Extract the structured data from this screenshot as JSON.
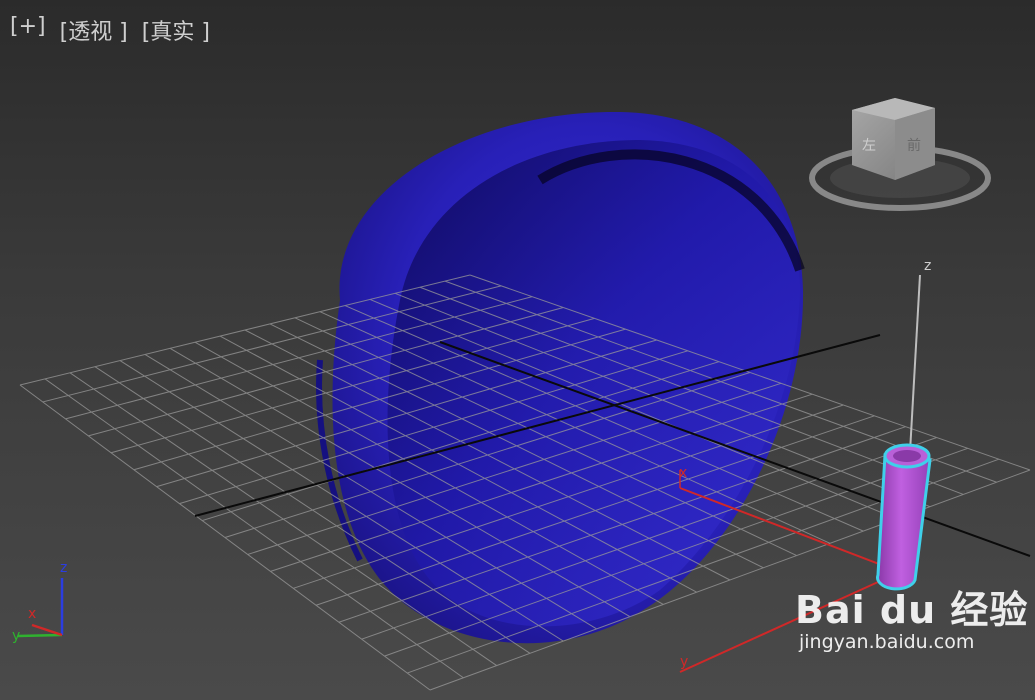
{
  "viewport": {
    "labels": [
      "[+]",
      "[透视 ]",
      "[真实 ]"
    ]
  },
  "colors": {
    "background_top": "#2b2b2b",
    "background_bottom": "#4a4a4a",
    "hemisphere": "#2a22c8",
    "cylinder": "#b04fd0",
    "selection_outline": "#3fd0ea",
    "axis_x": "#d02828",
    "axis_y": "#2fb12f",
    "axis_z": "#2b3de0"
  },
  "gizmo": {
    "x": "x",
    "y": "y",
    "z": "z"
  },
  "local_axes": {
    "x": "x",
    "y": "y",
    "z": "z"
  },
  "viewcube": {
    "icon": "viewcube-icon"
  },
  "watermark": {
    "brand": "Bai du 经验",
    "url": "jingyan.baidu.com"
  }
}
